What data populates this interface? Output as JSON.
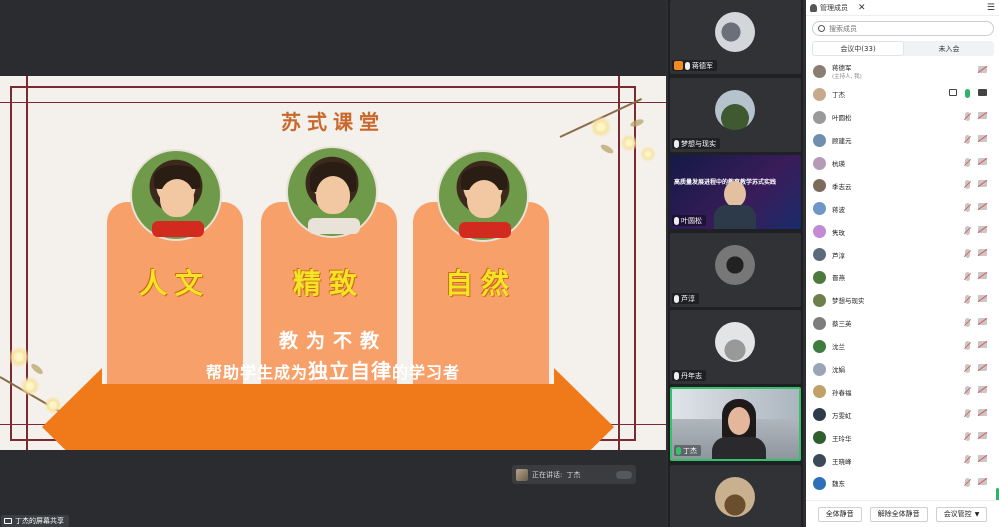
{
  "slide": {
    "title": "苏式课堂",
    "cards": [
      "人文",
      "精致",
      "自然"
    ],
    "motto_line1": "教为不教",
    "motto_line2_before": "帮助学生成为",
    "motto_line2_emphasis": "独立自律",
    "motto_line2_after": "的学习者"
  },
  "speaking": {
    "label": "正在讲话:",
    "name": "丁杰"
  },
  "share_badge": {
    "label": "丁杰的屏幕共享"
  },
  "video_tiles": [
    {
      "name": "蒋德军",
      "host": true
    },
    {
      "name": "梦想与现实"
    },
    {
      "name": "叶圆松",
      "slide_title": "高质量发展进程中的教育教学苏式实践"
    },
    {
      "name": "芦淳"
    },
    {
      "name": "丹年志"
    },
    {
      "name": "丁杰",
      "active": true
    },
    {
      "name": ""
    }
  ],
  "panel": {
    "title": "管理成员",
    "search_placeholder": "搜索成员",
    "tabs": [
      "会议中(33)",
      "未入会"
    ],
    "members": [
      {
        "name": "蒋德军",
        "sub": "(主持人, 我)",
        "color": "#8a7e72",
        "icons": "cam"
      },
      {
        "name": "丁杰",
        "color": "#c9a98b",
        "icons": "active"
      },
      {
        "name": "叶圆松",
        "color": "#9a9a9a"
      },
      {
        "name": "顾建元",
        "color": "#6f8fb0"
      },
      {
        "name": "杭瑛",
        "color": "#b59bb5"
      },
      {
        "name": "季志云",
        "color": "#7c6a5a"
      },
      {
        "name": "蒋波",
        "color": "#6e96c7"
      },
      {
        "name": "隽玫",
        "color": "#c38bd4"
      },
      {
        "name": "芦淳",
        "color": "#5b6b7c"
      },
      {
        "name": "晋燕",
        "color": "#4f7a3d"
      },
      {
        "name": "梦想与现实",
        "color": "#6f7f4a"
      },
      {
        "name": "蔡三英",
        "color": "#7e7e7e"
      },
      {
        "name": "沈兰",
        "color": "#3f7d3f"
      },
      {
        "name": "沈娟",
        "color": "#9aa5b8"
      },
      {
        "name": "孙春福",
        "color": "#c2a06a"
      },
      {
        "name": "万雯虹",
        "color": "#2e3b48"
      },
      {
        "name": "王玲华",
        "color": "#2f5f2f"
      },
      {
        "name": "王晓峰",
        "color": "#3b4a57"
      },
      {
        "name": "魏东",
        "color": "#2e6fb8"
      }
    ],
    "footer": {
      "mute_all": "全体静音",
      "unmute_all": "解除全体静音",
      "control": "会议管控"
    }
  }
}
